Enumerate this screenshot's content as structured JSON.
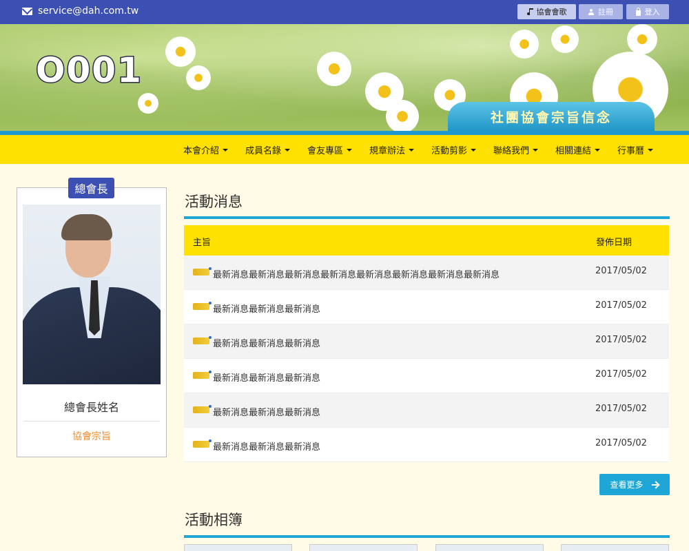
{
  "topbar": {
    "email": "service@dah.com.tw",
    "anthem_label": "協會會歌",
    "register_label": "註冊",
    "login_label": "登入"
  },
  "banner": {
    "logo": "O001",
    "motto": "社團協會宗旨信念"
  },
  "nav": {
    "items": [
      "本會介紹",
      "成員名錄",
      "會友專區",
      "規章辦法",
      "活動剪影",
      "聯絡我們",
      "相關連結",
      "行事曆"
    ]
  },
  "profile": {
    "badge": "總會長",
    "name": "總會長姓名",
    "purpose": "協會宗旨"
  },
  "news": {
    "title": "活動消息",
    "col_subject": "主旨",
    "col_date": "發佈日期",
    "rows": [
      {
        "subject": "最新消息最新消息最新消息最新消息最新消息最新消息最新消息最新消息",
        "date": "2017/05/02"
      },
      {
        "subject": "最新消息最新消息最新消息",
        "date": "2017/05/02"
      },
      {
        "subject": "最新消息最新消息最新消息",
        "date": "2017/05/02"
      },
      {
        "subject": "最新消息最新消息最新消息",
        "date": "2017/05/02"
      },
      {
        "subject": "最新消息最新消息最新消息",
        "date": "2017/05/02"
      },
      {
        "subject": "最新消息最新消息最新消息",
        "date": "2017/05/02"
      }
    ],
    "more_label": "查看更多"
  },
  "album": {
    "title": "活動相簿"
  },
  "colors": {
    "topbar": "#3c4fb3",
    "nav": "#ffe100",
    "accent": "#1ea7d6",
    "purpose": "#f08c2a"
  }
}
